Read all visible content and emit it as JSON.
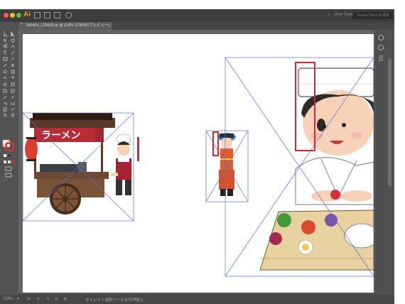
{
  "app": {
    "logo": "Ai",
    "brand_color": "#ff9a00"
  },
  "menubar": {
    "right_text": "Web Tools",
    "search_placeholder": "Adobe Stock を検索"
  },
  "document": {
    "tab_label": "180406_125830.ai @ 218% (CMYK/プレビュー)"
  },
  "statusbar": {
    "zoom": "218%",
    "page": "1",
    "tool_hint": "ダイレクト選択ツールを切り換え"
  },
  "artwork": {
    "ramen_sign": "ラーメン"
  },
  "icons": {
    "selection_color": "#5b6fc9",
    "highlight_color": "#c52b3a"
  }
}
